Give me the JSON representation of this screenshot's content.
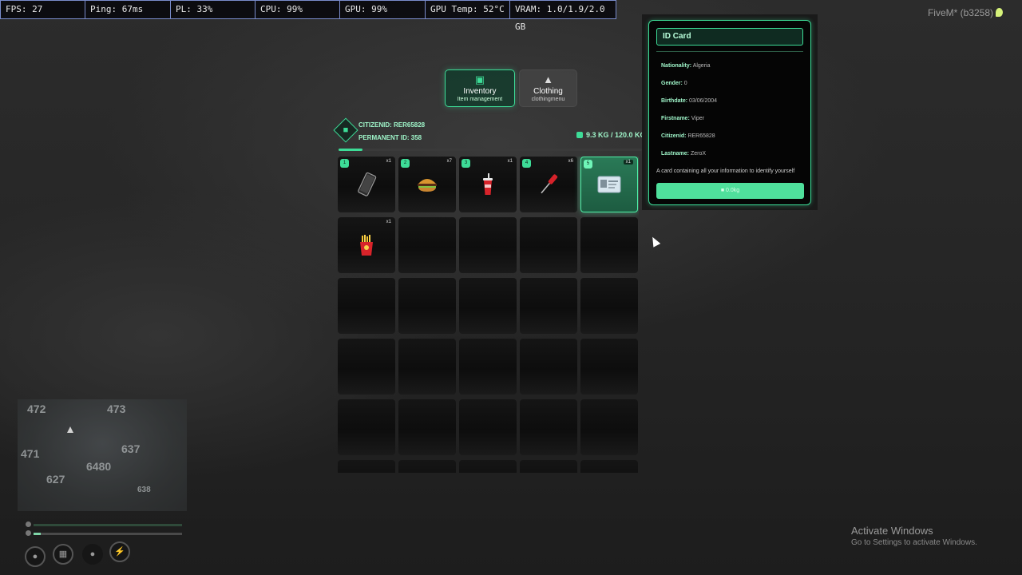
{
  "stats": [
    {
      "label": "FPS: 27",
      "width": 106
    },
    {
      "label": "Ping: 67ms",
      "width": 107
    },
    {
      "label": "PL: 33%",
      "width": 106
    },
    {
      "label": "CPU: 99%",
      "width": 106
    },
    {
      "label": "GPU: 99%",
      "width": 107
    },
    {
      "label": "GPU Temp: 52°C",
      "width": 106
    },
    {
      "label": "VRAM: 1.0/1.9/2.0 GB",
      "width": 132
    }
  ],
  "fivem_label": "FiveM* (b3258)",
  "tabs": {
    "inventory": {
      "title": "Inventory",
      "subtitle": "Item management"
    },
    "clothing": {
      "title": "Clothing",
      "subtitle": "clothingmenu"
    }
  },
  "player": {
    "citizenid_label": "CITIZENID: RER65828",
    "permanent_id_label": "PERMANENT ID: 358"
  },
  "weight": {
    "label": "9.3 KG / 120.0 KG",
    "fraction": 0.078
  },
  "slots": [
    {
      "num": "1",
      "amount": "x1",
      "item": "phone-icon"
    },
    {
      "num": "2",
      "amount": "x7",
      "item": "burger-icon"
    },
    {
      "num": "3",
      "amount": "x1",
      "item": "soda-cup-icon"
    },
    {
      "num": "4",
      "amount": "x6",
      "item": "screwdriver-icon"
    },
    {
      "num": "5",
      "amount": "x1",
      "item": "id-card-icon",
      "selected": true
    },
    {
      "num": "",
      "amount": "x1",
      "item": "fries-icon"
    },
    {},
    {},
    {},
    {},
    {},
    {},
    {},
    {},
    {},
    {},
    {},
    {},
    {},
    {},
    {},
    {},
    {},
    {},
    {},
    {},
    {},
    {},
    {},
    {}
  ],
  "tooltip": {
    "title": "ID Card",
    "rows": [
      {
        "key": "Nationality:",
        "value": "Algeria"
      },
      {
        "key": "Gender:",
        "value": "0"
      },
      {
        "key": "Birthdate:",
        "value": "03/06/2004"
      },
      {
        "key": "Firstname:",
        "value": "Viper"
      },
      {
        "key": "Citizenid:",
        "value": "RER65828"
      },
      {
        "key": "Lastname:",
        "value": "ZeroX"
      }
    ],
    "description": "A card containing all your information to identify yourself",
    "weight": "0.0kg"
  },
  "minimap": {
    "labels": [
      "472",
      "473",
      "471",
      "637",
      "6480",
      "627",
      "638"
    ]
  },
  "hud": {
    "armor_fraction": 0.05
  },
  "activate_windows": {
    "title": "Activate Windows",
    "subtitle": "Go to Settings to activate Windows."
  },
  "colors": {
    "accent": "#3ddc97",
    "accent_light": "#9ff5c9"
  }
}
